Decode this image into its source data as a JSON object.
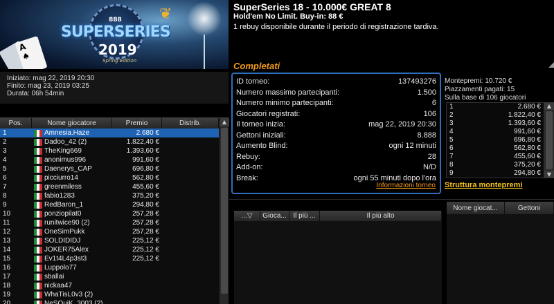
{
  "banner": {
    "brand": "888",
    "name": "SUPERSERIES",
    "year": "2019",
    "edition": "Spring Edition",
    "card_rank": "A",
    "card_suit": "♠"
  },
  "header": {
    "title": "SuperSeries 18 - 10.000€ GREAT 8",
    "subtitle": "Hold'em No Limit. Buy-in: 88 €",
    "rebuy_note": "1 rebuy disponibile durante il periodo di registrazione tardiva.",
    "status": "Completati"
  },
  "times": {
    "started": "Iniziato: mag 22, 2019 20:30",
    "finished": "Finito: mag 23, 2019 03:25",
    "duration": "Durata: 06h 54min"
  },
  "players_table": {
    "columns": [
      "Pos.",
      "Nome giocatore",
      "Premio",
      "Distrib."
    ],
    "rows": [
      {
        "pos": "1",
        "name": "Amnesia.Haze",
        "prize": "2.680 €",
        "selected": true
      },
      {
        "pos": "2",
        "name": "Dadoo_42 (2)",
        "prize": "1.822,40 €"
      },
      {
        "pos": "3",
        "name": "TheKing669",
        "prize": "1.393,60 €"
      },
      {
        "pos": "4",
        "name": "anonimus996",
        "prize": "991,60 €"
      },
      {
        "pos": "5",
        "name": "Daenerys_CAP",
        "prize": "696,80 €"
      },
      {
        "pos": "6",
        "name": "picciurro14",
        "prize": "562,80 €"
      },
      {
        "pos": "7",
        "name": "greenmiless",
        "prize": "455,60 €"
      },
      {
        "pos": "8",
        "name": "fabio1283",
        "prize": "375,20 €"
      },
      {
        "pos": "9",
        "name": "RedBaron_1",
        "prize": "294,80 €"
      },
      {
        "pos": "10",
        "name": "ponziopilat0",
        "prize": "257,28 €"
      },
      {
        "pos": "11",
        "name": "runitwice90 (2)",
        "prize": "257,28 €"
      },
      {
        "pos": "12",
        "name": "OneSimPukk",
        "prize": "257,28 €"
      },
      {
        "pos": "13",
        "name": "SOLDIDIDJ",
        "prize": "225,12 €"
      },
      {
        "pos": "14",
        "name": "JOKER75Alex",
        "prize": "225,12 €"
      },
      {
        "pos": "15",
        "name": "Ev1t4L4p3st3",
        "prize": "225,12 €"
      },
      {
        "pos": "16",
        "name": "Luppolo77",
        "prize": ""
      },
      {
        "pos": "17",
        "name": "sballai",
        "prize": ""
      },
      {
        "pos": "18",
        "name": "nickaa47",
        "prize": ""
      },
      {
        "pos": "19",
        "name": "WhaTisL0v3 (2)",
        "prize": ""
      },
      {
        "pos": "20",
        "name": "NeSQuiK_3003 (2)",
        "prize": ""
      }
    ]
  },
  "info": {
    "rows": [
      {
        "label": "ID torneo:",
        "value": "137493276"
      },
      {
        "label": "Numero massimo partecipanti:",
        "value": "1.500"
      },
      {
        "label": "Numero minimo partecipanti:",
        "value": "6"
      },
      {
        "label": "Giocatori registrati:",
        "value": "106"
      },
      {
        "label": "Il torneo inizia:",
        "value": "mag 22, 2019 20:30"
      },
      {
        "label": "Gettoni iniziali:",
        "value": "8.888"
      },
      {
        "label": "Aumento Blind:",
        "value": "ogni 12 minuti"
      },
      {
        "label": "Rebuy:",
        "value": "28"
      },
      {
        "label": "Add-on:",
        "value": "N/D"
      },
      {
        "label": "Break:",
        "value": "ogni 55 minuti dopo l'ora"
      }
    ],
    "link": "Informazioni torneo"
  },
  "pool": {
    "total": "Montepremi: 10.720 €",
    "paid": "Piazzamenti pagati: 15",
    "basis": "Sulla base di 106 giocatori",
    "rows": [
      {
        "place": "1",
        "prize": "2.680 €"
      },
      {
        "place": "2",
        "prize": "1.822,40 €"
      },
      {
        "place": "3",
        "prize": "1.393,60 €"
      },
      {
        "place": "4",
        "prize": "991,60 €"
      },
      {
        "place": "5",
        "prize": "696,80 €"
      },
      {
        "place": "6",
        "prize": "562,80 €"
      },
      {
        "place": "7",
        "prize": "455,60 €"
      },
      {
        "place": "8",
        "prize": "375,20 €"
      },
      {
        "place": "9",
        "prize": "294,80 €"
      },
      {
        "place": "10",
        "prize": "257,28 €"
      }
    ],
    "link": "Struttura montepremi"
  },
  "tables": {
    "columns": [
      "...▽",
      "Gioca...",
      "Il più ...",
      "Il più alto"
    ]
  },
  "player_list": {
    "columns": [
      "Nome giocat...",
      "Gettoni"
    ]
  },
  "colors": {
    "selected_row": "#1e62b4",
    "accent_orange": "#f39a1e",
    "link_yellow": "#f3c21e",
    "panel_border": "#2f6fc0"
  },
  "icons": {
    "flag": "italy-flag-icon",
    "scroll_up": "scroll-up-icon",
    "scroll_down": "scroll-down-icon"
  }
}
